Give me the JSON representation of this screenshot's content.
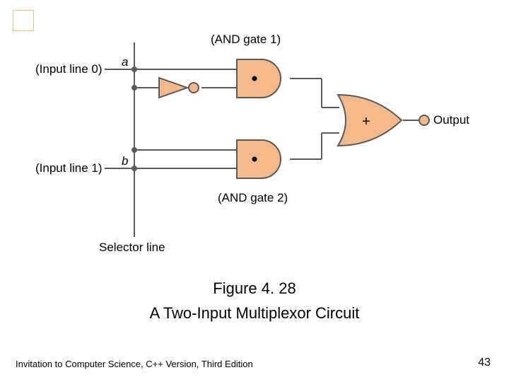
{
  "figure": {
    "number": "Figure 4. 28",
    "title": "A Two-Input Multiplexor Circuit"
  },
  "labels": {
    "input0": "(Input line 0)",
    "input1": "(Input line 1)",
    "a": "a",
    "b": "b",
    "and1": "(AND gate 1)",
    "and2": "(AND gate 2)",
    "selector": "Selector line",
    "output": "Output",
    "plus": "+"
  },
  "footer": {
    "book": "Invitation to Computer Science, C++ Version, Third Edition",
    "page": "43"
  },
  "colors": {
    "gate_fill": "#f4b98a",
    "gate_stroke": "#5a5a5a",
    "wire": "#5a5a5a"
  }
}
